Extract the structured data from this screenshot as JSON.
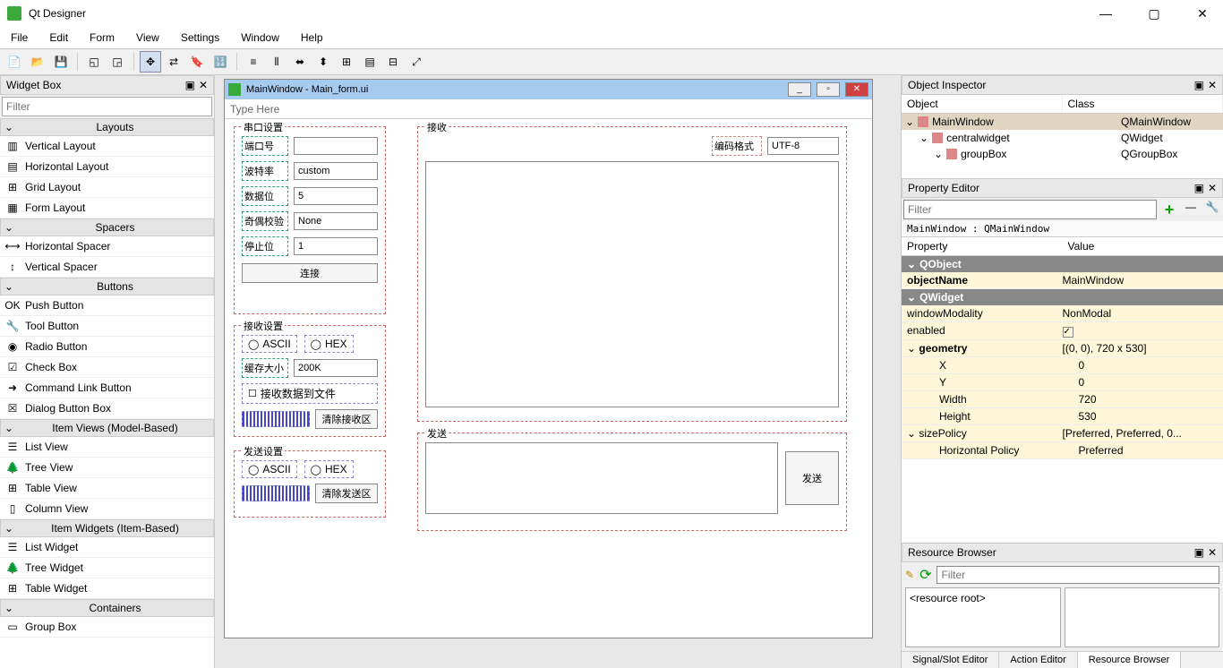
{
  "app": {
    "title": "Qt Designer"
  },
  "menu": [
    "File",
    "Edit",
    "Form",
    "View",
    "Settings",
    "Window",
    "Help"
  ],
  "widgetbox": {
    "title": "Widget Box",
    "filter_ph": "Filter",
    "cats": [
      {
        "name": "Layouts",
        "items": [
          "Vertical Layout",
          "Horizontal Layout",
          "Grid Layout",
          "Form Layout"
        ]
      },
      {
        "name": "Spacers",
        "items": [
          "Horizontal Spacer",
          "Vertical Spacer"
        ]
      },
      {
        "name": "Buttons",
        "items": [
          "Push Button",
          "Tool Button",
          "Radio Button",
          "Check Box",
          "Command Link Button",
          "Dialog Button Box"
        ]
      },
      {
        "name": "Item Views (Model-Based)",
        "items": [
          "List View",
          "Tree View",
          "Table View",
          "Column View"
        ]
      },
      {
        "name": "Item Widgets (Item-Based)",
        "items": [
          "List Widget",
          "Tree Widget",
          "Table Widget"
        ]
      },
      {
        "name": "Containers",
        "items": [
          "Group Box"
        ]
      }
    ]
  },
  "design": {
    "title": "MainWindow - Main_form.ui",
    "menuhint": "Type Here",
    "groups": {
      "serial": {
        "title": "串口设置",
        "rows": [
          {
            "label": "端口号",
            "value": ""
          },
          {
            "label": "波特率",
            "value": "custom"
          },
          {
            "label": "数据位",
            "value": "5"
          },
          {
            "label": "奇偶校验",
            "value": "None"
          },
          {
            "label": "停止位",
            "value": "1"
          }
        ],
        "connect": "连接"
      },
      "recvset": {
        "title": "接收设置",
        "radios": [
          "ASCII",
          "HEX"
        ],
        "buf_label": "缓存大小",
        "buf_value": "200K",
        "save_to_file": "接收数据到文件",
        "clear": "清除接收区"
      },
      "sendset": {
        "title": "发送设置",
        "radios": [
          "ASCII",
          "HEX"
        ],
        "clear": "清除发送区"
      },
      "recv": {
        "title": "接收",
        "enc_label": "编码格式",
        "enc_value": "UTF-8"
      },
      "send": {
        "title": "发送",
        "btn": "发送"
      }
    }
  },
  "inspector": {
    "title": "Object Inspector",
    "cols": [
      "Object",
      "Class"
    ],
    "tree": [
      {
        "name": "MainWindow",
        "cls": "QMainWindow",
        "depth": 0,
        "sel": true
      },
      {
        "name": "centralwidget",
        "cls": "QWidget",
        "depth": 1
      },
      {
        "name": "groupBox",
        "cls": "QGroupBox",
        "depth": 2
      }
    ]
  },
  "propeditor": {
    "title": "Property Editor",
    "filter_ph": "Filter",
    "path": "MainWindow : QMainWindow",
    "cols": [
      "Property",
      "Value"
    ],
    "groups": [
      {
        "cat": "QObject",
        "rows": [
          {
            "name": "objectName",
            "val": "MainWindow",
            "bold": true
          }
        ]
      },
      {
        "cat": "QWidget",
        "rows": [
          {
            "name": "windowModality",
            "val": "NonModal"
          },
          {
            "name": "enabled",
            "val": "",
            "check": true
          },
          {
            "name": "geometry",
            "val": "[(0, 0), 720 x 530]",
            "bold": true,
            "exp": true
          },
          {
            "name": "X",
            "val": "0",
            "indent": 2
          },
          {
            "name": "Y",
            "val": "0",
            "indent": 2
          },
          {
            "name": "Width",
            "val": "720",
            "indent": 2
          },
          {
            "name": "Height",
            "val": "530",
            "indent": 2
          },
          {
            "name": "sizePolicy",
            "val": "[Preferred, Preferred, 0...",
            "exp": true
          },
          {
            "name": "Horizontal Policy",
            "val": "Preferred",
            "indent": 2
          }
        ]
      }
    ]
  },
  "resbrowser": {
    "title": "Resource Browser",
    "filter_ph": "Filter",
    "root": "<resource root>",
    "tabs": [
      "Signal/Slot Editor",
      "Action Editor",
      "Resource Browser"
    ],
    "active_tab": 2
  }
}
